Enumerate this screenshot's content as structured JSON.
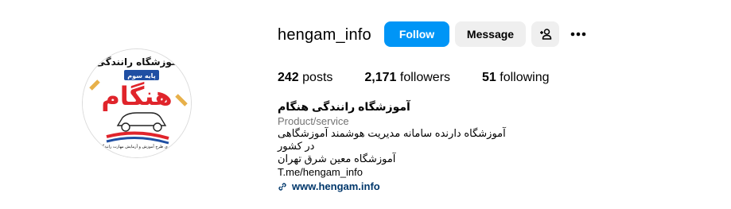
{
  "profile": {
    "username": "hengam_info",
    "avatar": {
      "title_line": "آموزشگاه رانندگی",
      "badge": "پایه سوم",
      "brand": "هنگام",
      "footer_line": "مجری طرح آموزش و آزمایش مهارت رانندگی"
    }
  },
  "actions": {
    "follow_label": "Follow",
    "message_label": "Message",
    "suggest_icon": "person-add-icon",
    "more_icon": "more-options-icon"
  },
  "stats": {
    "posts_count": "242",
    "posts_label": " posts",
    "followers_count": "2,171",
    "followers_label": " followers",
    "following_count": "51",
    "following_label": " following"
  },
  "bio": {
    "name": "آموزشگاه رانندگی هنگام",
    "category": "Product/service",
    "line1": "آموزشگاه دارنده سامانه مدیریت هوشمند آموزشگاهی در کشور",
    "line2": "آموزشگاه معین شرق تهران",
    "link_text": "T.me/hengam_info",
    "website": "www.hengam.info",
    "website_icon": "link-icon"
  },
  "colors": {
    "primary": "#0095f6",
    "secondary_bg": "#efefef",
    "link": "#00376b",
    "muted": "#737373",
    "avatar_red": "#e0242b"
  }
}
